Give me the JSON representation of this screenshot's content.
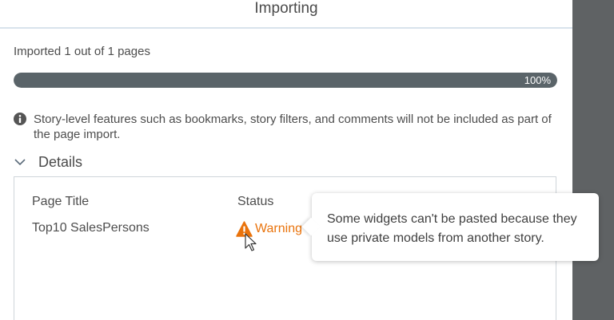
{
  "dialog": {
    "title": "Importing",
    "import_status": "Imported 1 out of 1 pages",
    "progress": {
      "value": 100,
      "label": "100%"
    },
    "info_message": "Story-level features such as bookmarks, story filters, and comments will not be included as part of the page import.",
    "details": {
      "toggle_label": "Details",
      "expanded": true,
      "columns": [
        "Page Title",
        "Status"
      ],
      "rows": [
        {
          "page_title": "Top10 SalesPersons",
          "status": "Warning",
          "status_icon": "warning-triangle-icon"
        }
      ]
    },
    "tooltip": {
      "text": "Some widgets can't be pasted because they use private models from another story."
    }
  },
  "colors": {
    "progress_fill": "#5a6469",
    "warning": "#e9730c",
    "overlay": "#5f6264"
  }
}
